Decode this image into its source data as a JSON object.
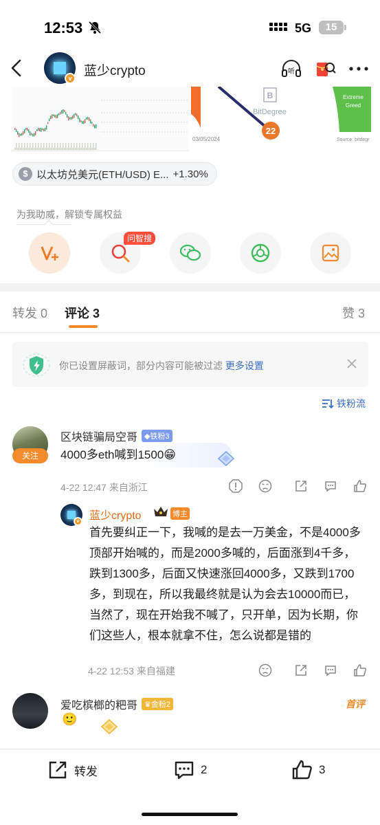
{
  "status_bar": {
    "time": "12:53",
    "network": "5G",
    "battery": "15"
  },
  "header": {
    "author_name": "蓝少crypto",
    "listen_label": "听",
    "verified_mark": "v"
  },
  "attachment": {
    "ticker_icon": "$",
    "ticker_label": "以太坊兑美元(ETH/USD) E...",
    "ticker_change": "+1.30%",
    "right_image": {
      "brand": "BitDegree",
      "value": "22",
      "extreme_label": "Extreme",
      "greed_label": "Greed",
      "date": "03/05/2024",
      "source": "Source: bitdegr"
    }
  },
  "support": {
    "text": "为我助威，解锁专属权益",
    "wenzhisou_tag": "问智搜",
    "actions": [
      "v-plus-icon",
      "search-icon",
      "wechat-icon",
      "moments-icon",
      "image-save-icon"
    ]
  },
  "tabs": [
    {
      "label": "转发",
      "count": "0"
    },
    {
      "label": "评论",
      "count": "3"
    },
    {
      "label": "赞",
      "count": "3"
    }
  ],
  "notice": {
    "text": "你已设置屏蔽词，部分内容可能被过滤",
    "link": "更多设置"
  },
  "sort": {
    "label": "铁粉流"
  },
  "comments": [
    {
      "name": "区块链骗局空哥",
      "badge": "铁粉3",
      "follow_label": "关注",
      "text": "4000多eth喊到1500",
      "emoji": "😁",
      "time": "4-22 12:47",
      "location": "来自浙江",
      "reply": {
        "name": "蓝少crypto",
        "role": "博主",
        "text": "首先要纠正一下，我喊的是去一万美金，不是4000多顶部开始喊的，而是2000多喊的，后面涨到4千多，跌到1300多，后面又快速涨回4000多，又跌到1700多，到现在，所以我最终就是认为会去10000而已，当然了，现在开始我不喊了，只开单，因为长期，你们这些人，根本就拿不住，怎么说都是错的",
        "time": "4-22 12:53",
        "location": "来自福建"
      }
    },
    {
      "name": "爱吃槟榔的粑哥",
      "badge": "金粉2",
      "tag": "首评",
      "emoji": "🙂"
    }
  ],
  "bottom_bar": {
    "repost_label": "转发",
    "comment_count": "2",
    "like_count": "3"
  },
  "colors": {
    "accent": "#f28a2b",
    "link": "#3a6fc4",
    "author": "#e46a16"
  }
}
